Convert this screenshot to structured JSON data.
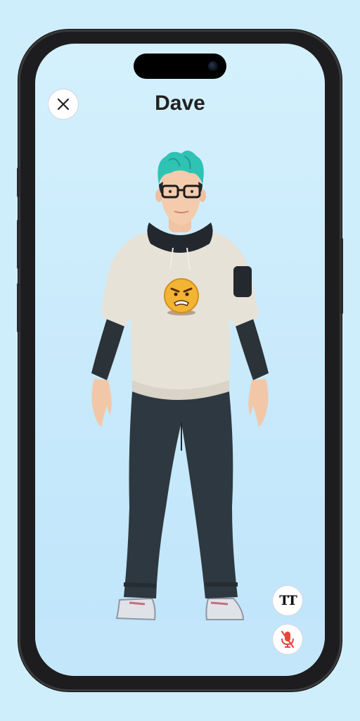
{
  "header": {
    "title": "Dave"
  },
  "buttons": {
    "close": {
      "icon": "close-icon"
    },
    "text_style": {
      "icon": "text-size-icon",
      "label": "TT"
    },
    "mic": {
      "icon": "mic-muted-icon",
      "color": "#e8453c"
    }
  },
  "avatar": {
    "hair_color": "#2fc3b4",
    "shirt_color": "#e7e2d8",
    "sleeve_color": "#2b3238",
    "pants_color": "#2e3840",
    "emoji_color": "#f2b533"
  }
}
